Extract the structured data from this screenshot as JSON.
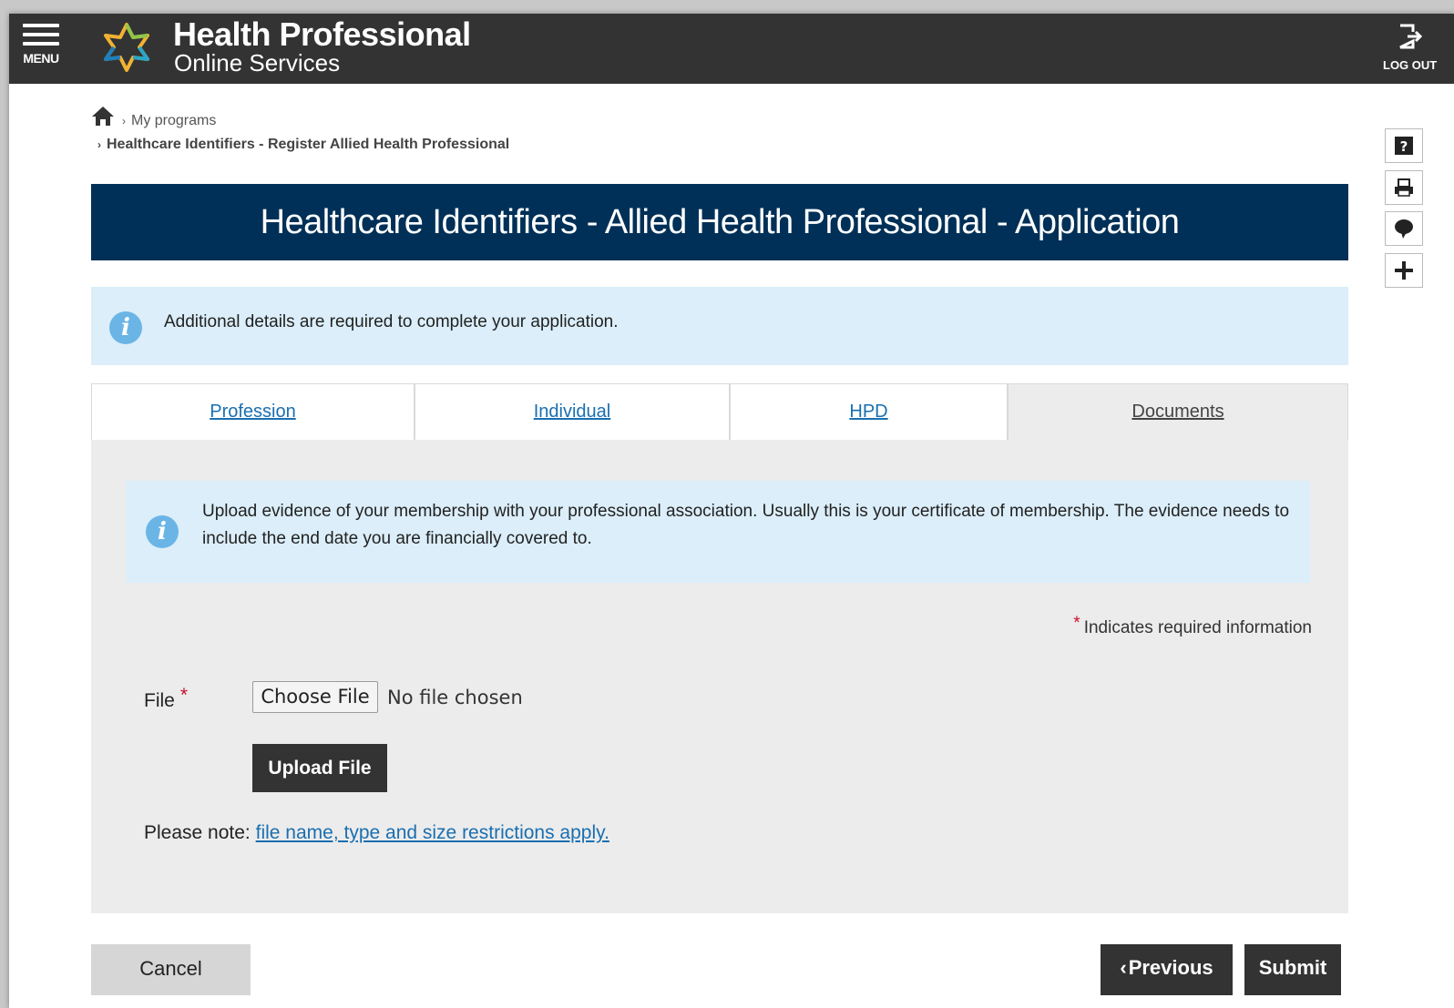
{
  "header": {
    "menu_label": "MENU",
    "brand_title": "Health Professional",
    "brand_subtitle": "Online Services",
    "logout_label": "LOG OUT"
  },
  "breadcrumb": {
    "items": [
      "My programs",
      "Healthcare Identifiers - Register Allied Health Professional"
    ]
  },
  "side_tools": [
    "help-icon",
    "print-icon",
    "feedback-icon",
    "expand-icon"
  ],
  "page_title": "Healthcare Identifiers - Allied Health Professional - Application",
  "info_banner": {
    "message": "Additional details are required to complete your application."
  },
  "tabs": [
    {
      "label": "Profession",
      "active": false
    },
    {
      "label": "Individual",
      "active": false
    },
    {
      "label": "HPD",
      "active": false
    },
    {
      "label": "Documents",
      "active": true
    }
  ],
  "documents": {
    "info_message": "Upload evidence of your membership with your professional association. Usually this is your certificate of membership. The evidence needs to include the end date you are financially covered to.",
    "required_star": "*",
    "required_note": "Indicates required information",
    "file_label": "File",
    "choose_file_label": "Choose File",
    "no_file_text": "No file chosen",
    "upload_label": "Upload File",
    "note_prefix": "Please note:",
    "note_link": "file name, type and size restrictions apply."
  },
  "actions": {
    "cancel_label": "Cancel",
    "previous_label": "Previous",
    "submit_label": "Submit"
  },
  "colors": {
    "header_bg": "#333333",
    "title_bg": "#003057",
    "info_bg": "#dbeef9",
    "info_icon": "#6ab5e6",
    "link": "#1a6fb0",
    "required": "#c8102e"
  }
}
